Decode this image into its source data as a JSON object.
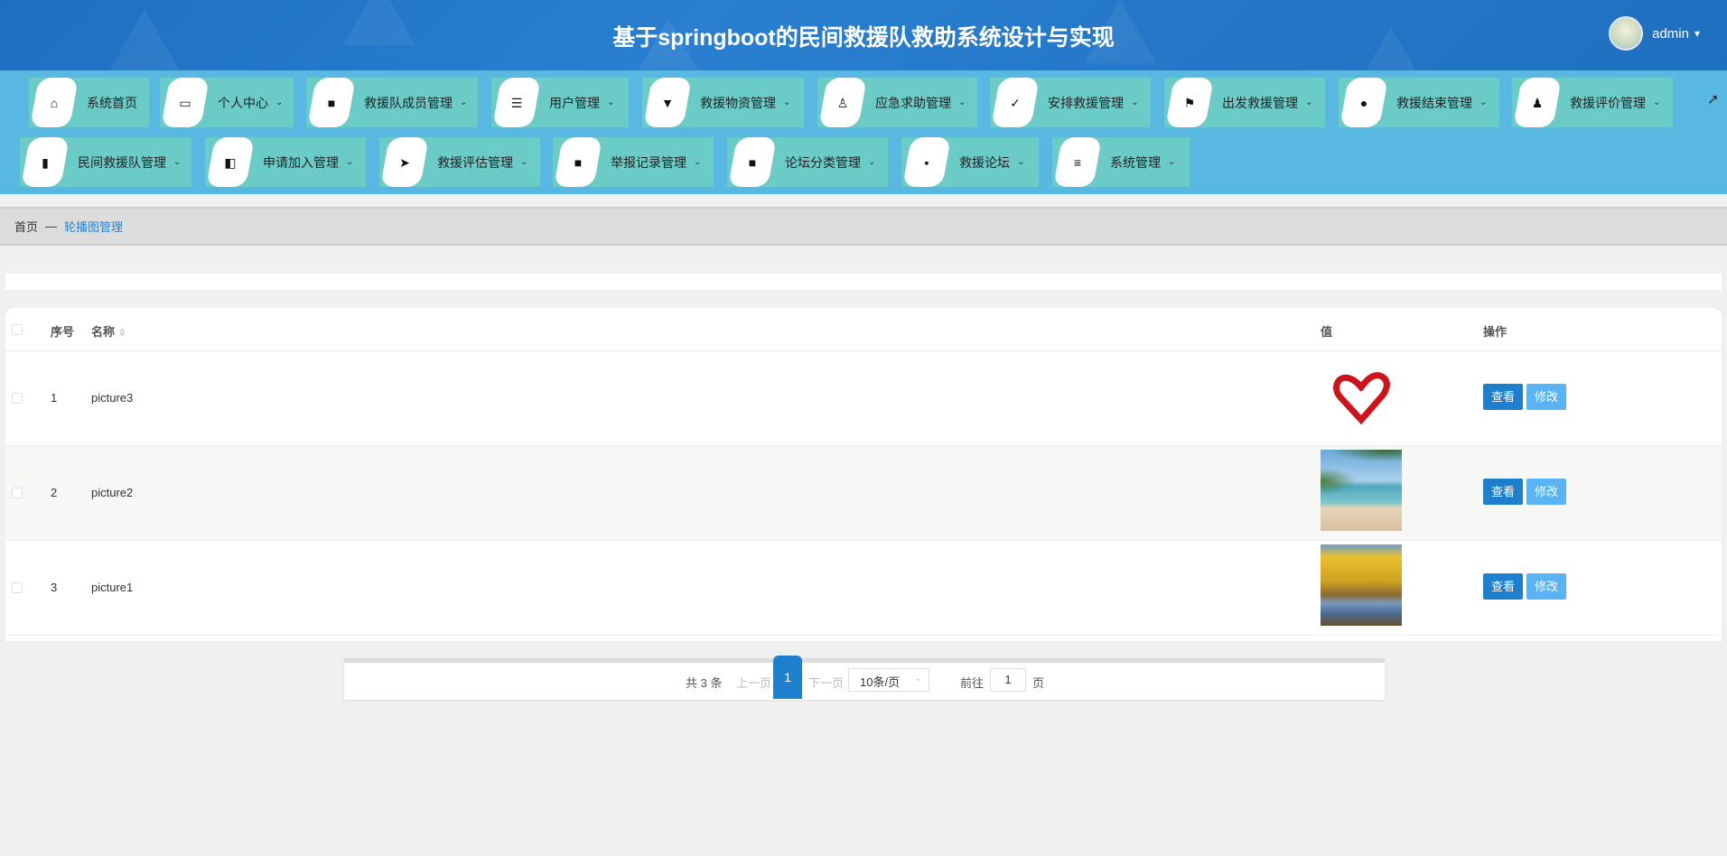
{
  "header": {
    "title": "基于springboot的民间救援队救助系统设计与实现",
    "username": "admin",
    "caret": "▾"
  },
  "nav": [
    {
      "label": "系统首页",
      "icon": "home-icon",
      "glyph": "⌂",
      "dropdown": false
    },
    {
      "label": "个人中心",
      "icon": "card-icon",
      "glyph": "▭",
      "dropdown": true
    },
    {
      "label": "救援队成员管理",
      "icon": "grid-icon",
      "glyph": "■",
      "dropdown": true
    },
    {
      "label": "用户管理",
      "icon": "sliders-icon",
      "glyph": "☰",
      "dropdown": true
    },
    {
      "label": "救援物资管理",
      "icon": "brush-icon",
      "glyph": "▼",
      "dropdown": true
    },
    {
      "label": "应急求助管理",
      "icon": "stamp-icon",
      "glyph": "♙",
      "dropdown": true
    },
    {
      "label": "安排救援管理",
      "icon": "clipboard-check-icon",
      "glyph": "✓",
      "dropdown": true
    },
    {
      "label": "出发救援管理",
      "icon": "flag-icon",
      "glyph": "⚑",
      "dropdown": true
    },
    {
      "label": "救援结束管理",
      "icon": "bulb-icon",
      "glyph": "●",
      "dropdown": true
    },
    {
      "label": "救援评价管理",
      "icon": "user-icon",
      "glyph": "♟",
      "dropdown": true
    },
    {
      "label": "民间救援队管理",
      "icon": "book-icon",
      "glyph": "▮",
      "dropdown": true
    },
    {
      "label": "申请加入管理",
      "icon": "wallet-icon",
      "glyph": "◧",
      "dropdown": true
    },
    {
      "label": "救援评估管理",
      "icon": "send-icon",
      "glyph": "➤",
      "dropdown": true
    },
    {
      "label": "举报记录管理",
      "icon": "grid-icon",
      "glyph": "■",
      "dropdown": true
    },
    {
      "label": "论坛分类管理",
      "icon": "grid-icon",
      "glyph": "■",
      "dropdown": true
    },
    {
      "label": "救援论坛",
      "icon": "comment-icon",
      "glyph": "▪",
      "dropdown": true
    },
    {
      "label": "系统管理",
      "icon": "menu-icon",
      "glyph": "≡",
      "dropdown": true
    }
  ],
  "chevron": "⌄",
  "breadcrumb": {
    "home": "首页",
    "sep": "—",
    "current": "轮播图管理"
  },
  "table": {
    "headers": {
      "index": "序号",
      "name": "名称",
      "value": "值",
      "actions": "操作"
    },
    "sort_icon": "⇳",
    "rows": [
      {
        "index": "1",
        "name": "picture3",
        "image": "heart-hand"
      },
      {
        "index": "2",
        "name": "picture2",
        "image": "beach"
      },
      {
        "index": "3",
        "name": "picture1",
        "image": "autumn"
      }
    ],
    "view_label": "查看",
    "edit_label": "修改"
  },
  "pagination": {
    "total": "共 3 条",
    "prev": "上一页",
    "current": "1",
    "next": "下一页",
    "page_size": "10条/页",
    "goto": "前往",
    "goto_value": "1",
    "page_unit": "页"
  }
}
